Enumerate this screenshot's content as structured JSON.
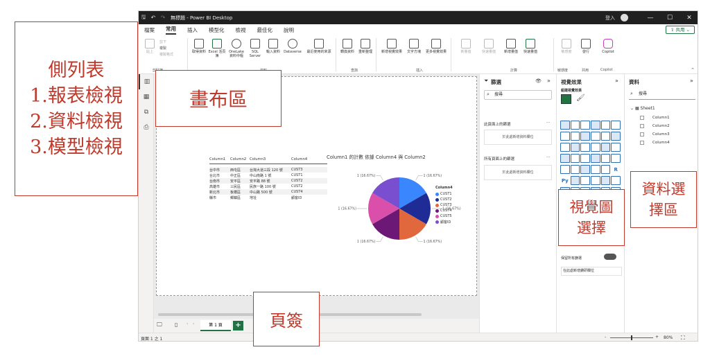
{
  "titlebar": {
    "title": "無標題 - Power BI Desktop",
    "user_label": "登入",
    "min": "—",
    "max": "☐",
    "close": "✕"
  },
  "menubar": {
    "items": [
      "檔案",
      "常用",
      "插入",
      "模型化",
      "檢視",
      "最佳化",
      "說明"
    ],
    "active_index": 1,
    "share_label": "共用"
  },
  "ribbon": {
    "clipboard": {
      "paste": "貼上",
      "cut": "剪下",
      "copy": "複製",
      "format_painter": "複製格式",
      "group": "剪貼簿"
    },
    "data": {
      "get_data": "取得資料",
      "excel": "Excel 活頁簿",
      "onelake": "OneLake 資料中樞",
      "sql": "SQL Server",
      "enter_data": "輸入資料",
      "dataverse": "Dataverse",
      "recent": "最近使用的來源",
      "group": "資料"
    },
    "queries": {
      "transform": "轉換資料",
      "refresh": "重新整理",
      "group": "查詢"
    },
    "insert": {
      "new_visual": "新增視覺效果",
      "textbox": "文字方塊",
      "more_visuals": "更多視覺效果",
      "group": "插入"
    },
    "calc": {
      "new_measure_disabled": "新量值",
      "quick_measure_disabled": "快速量值",
      "new_measure": "新增量值",
      "quick_measure": "快速量值",
      "group": "計算"
    },
    "sensitivity": {
      "label": "敏感度",
      "group": "敏感度"
    },
    "share": {
      "publish": "發行",
      "group": "共用"
    },
    "copilot": {
      "label": "Copilot",
      "group": "Copilot"
    }
  },
  "table_visual": {
    "headers": [
      "Column1",
      "Column2",
      "Column3",
      "Column4"
    ],
    "rows": [
      [
        "台中市",
        "西屯區",
        "台灣大道三段 120 號",
        "CUST3"
      ],
      [
        "台北市",
        "中正區",
        "中山南路 1 號",
        "CUST1"
      ],
      [
        "台南市",
        "安平區",
        "安平路 88 號",
        "CUST2"
      ],
      [
        "高雄市",
        "三民區",
        "民族一路 100 號",
        "CUST2"
      ],
      [
        "新北市",
        "板橋區",
        "中山路 500 號",
        "CUST4"
      ],
      [
        "縣市",
        "鄉鎮區",
        "地址",
        "顧客ID"
      ]
    ]
  },
  "chart_data": {
    "type": "pie",
    "title": "Column1 的計數 依據 Column4 與 Column2",
    "legend_title": "Column4",
    "legend_position": "right",
    "categories": [
      "CUST1",
      "CUST2",
      "CUST3",
      "CUST4",
      "CUST5",
      "顧客ID"
    ],
    "slices": [
      {
        "legend": "CUST1",
        "color": "#3a86ff",
        "value": 1,
        "label": "1 (16.67%)"
      },
      {
        "legend": "CUST2",
        "color": "#1f2c96",
        "value": 1,
        "label": "1 (16.67%)"
      },
      {
        "legend": "CUST3",
        "color": "#e0683c",
        "value": 1,
        "label": "1 (16.67%)"
      },
      {
        "legend": "CUST4",
        "color": "#6b1877",
        "value": 1,
        "label": "1 (16.67%)"
      },
      {
        "legend": "CUST5",
        "color": "#d94faa",
        "value": 1,
        "label": "1 (16.67%)"
      },
      {
        "legend": "顧客ID",
        "color": "#7a4fcf",
        "value": 1,
        "label": "1 (16.67%)"
      }
    ]
  },
  "pagebar": {
    "page_label": "第 1 頁",
    "add": "+"
  },
  "statusbar": {
    "page_info": "頁面 1 之 1",
    "zoom": "80%",
    "minus": "-",
    "plus": "+"
  },
  "filter_pane": {
    "title": "篩選",
    "search_placeholder": "搜尋",
    "this_page": "此頁面上的篩選",
    "drop_page": "於此處新增資料欄位",
    "all_pages": "所有頁面上的篩選",
    "drop_all": "於此處新增資料欄位"
  },
  "viz_pane": {
    "title": "視覺效果",
    "build": "組建視覺效果",
    "keep_filters": "保留所有篩選",
    "drill_field": "在此處新增鑽研欄位",
    "r_label": "R",
    "py_label": "Py"
  },
  "data_pane": {
    "title": "資料",
    "search_placeholder": "搜尋",
    "table_name": "Sheet1",
    "fields": [
      "Column1",
      "Column2",
      "Column3",
      "Column4"
    ]
  },
  "annotations": {
    "sidebar_title": "側列表",
    "sidebar_1": "1.報表檢視",
    "sidebar_2": "2.資料檢視",
    "sidebar_3": "3.模型檢視",
    "canvas": "畫布區",
    "pages": "頁簽",
    "viz_1": "視覺圖",
    "viz_2": "選擇",
    "data_1": "資料選",
    "data_2": "擇區"
  }
}
